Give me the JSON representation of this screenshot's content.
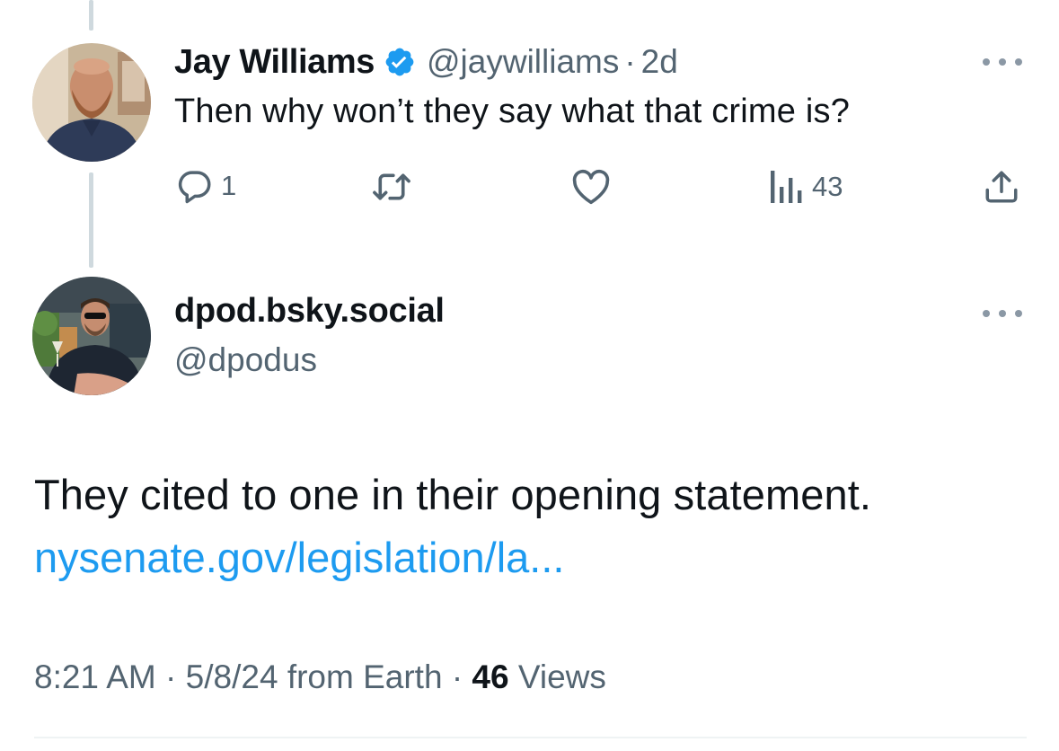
{
  "reply_tweet": {
    "author_name": "Jay Williams",
    "verified_icon": "verified-badge-icon",
    "handle": "@jaywilliams",
    "separator": "·",
    "time_ago": "2d",
    "text": "Then why won’t they say what that crime is?",
    "actions": {
      "reply_count": "1",
      "retweet_count": "",
      "like_count": "",
      "views_count": "43"
    }
  },
  "main_tweet": {
    "display_name": "dpod.bsky.social",
    "handle": "@dpodus",
    "text": "They cited to one in their opening statement.",
    "link_text": "nysenate.gov/legislation/la...",
    "timestamp_time": "8:21 AM",
    "separator": "·",
    "timestamp_date": "5/8/24",
    "source": "from Earth",
    "views_count": "46",
    "views_label": "Views"
  },
  "colors": {
    "text_primary": "#0f1419",
    "text_secondary": "#536471",
    "link": "#1d9bf0",
    "verified": "#1d9bf0",
    "thread_line": "#cfd9de"
  },
  "icons": [
    "more-options-icon",
    "reply-icon",
    "retweet-icon",
    "like-icon",
    "views-icon",
    "share-icon",
    "verified-badge-icon"
  ]
}
